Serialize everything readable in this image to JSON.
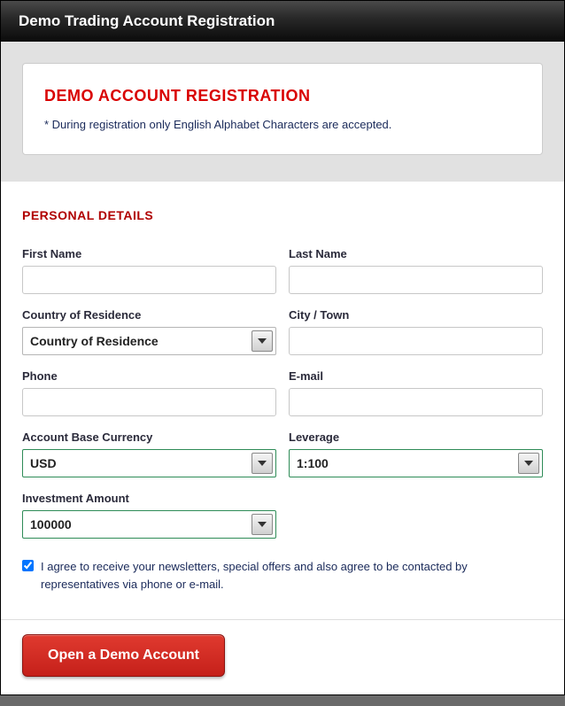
{
  "header": {
    "title": "Demo Trading Account Registration"
  },
  "intro": {
    "title": "DEMO ACCOUNT REGISTRATION",
    "note": "* During registration only English Alphabet Characters are accepted."
  },
  "section": {
    "heading": "PERSONAL DETAILS"
  },
  "fields": {
    "first_name": {
      "label": "First Name",
      "value": ""
    },
    "last_name": {
      "label": "Last Name",
      "value": ""
    },
    "country": {
      "label": "Country of Residence",
      "selected": "Country of Residence"
    },
    "city": {
      "label": "City / Town",
      "value": ""
    },
    "phone": {
      "label": "Phone",
      "value": ""
    },
    "email": {
      "label": "E-mail",
      "value": ""
    },
    "currency": {
      "label": "Account Base Currency",
      "selected": "USD"
    },
    "leverage": {
      "label": "Leverage",
      "selected": "1:100"
    },
    "investment": {
      "label": "Investment Amount",
      "selected": "100000"
    }
  },
  "agree": {
    "checked": true,
    "text": "I agree to receive your newsletters, special offers and also agree to be contacted by representatives via phone or e-mail."
  },
  "submit": {
    "label": "Open a Demo Account"
  }
}
